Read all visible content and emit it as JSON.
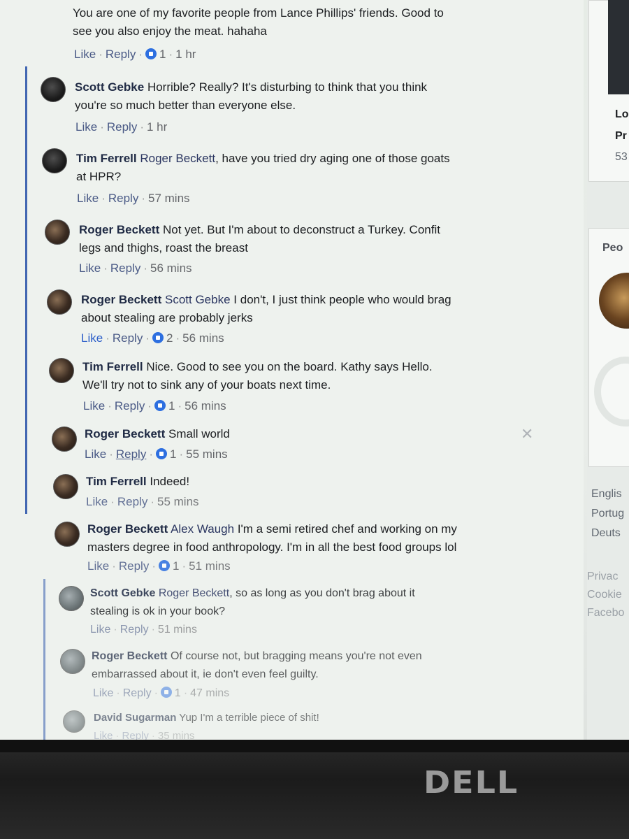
{
  "comments": [
    {
      "author": "",
      "mention": "",
      "text": "You are one of my favorite people from Lance Phillips' friends. Good to",
      "text2": "see you also enjoy the meat. hahaha",
      "like": "Like",
      "reply": "Reply",
      "reactions": "1",
      "time": "1 hr"
    },
    {
      "author": "Scott Gebke",
      "mention": "",
      "text": "Horrible? Really? It's disturbing to think that you think",
      "text2": "you're so much better than everyone else.",
      "like": "Like",
      "reply": "Reply",
      "reactions": "",
      "time": "1 hr"
    },
    {
      "author": "Tim Ferrell",
      "mention": "Roger Beckett",
      "text": ", have you tried dry aging one of those goats",
      "text2": "at HPR?",
      "like": "Like",
      "reply": "Reply",
      "reactions": "",
      "time": "57 mins"
    },
    {
      "author": "Roger Beckett",
      "mention": "",
      "text": "Not yet. But I'm about to deconstruct a Turkey. Confit",
      "text2": "legs and thighs, roast the breast",
      "like": "Like",
      "reply": "Reply",
      "reactions": "",
      "time": "56 mins"
    },
    {
      "author": "Roger Beckett",
      "mention": "Scott Gebke",
      "text": "I don't, I just think people who would brag",
      "text2": "about stealing are probably jerks",
      "like": "Like",
      "reply": "Reply",
      "reactions": "2",
      "time": "56 mins"
    },
    {
      "author": "Tim Ferrell",
      "mention": "",
      "text": "Nice. Good to see you on the board. Kathy says Hello.",
      "text2": "We'll try not to sink any of your boats next time.",
      "like": "Like",
      "reply": "Reply",
      "reactions": "1",
      "time": "56 mins"
    },
    {
      "author": "Roger Beckett",
      "mention": "",
      "text": "Small world",
      "text2": "",
      "like": "Like",
      "reply": "Reply",
      "reactions": "1",
      "time": "55 mins"
    },
    {
      "author": "Tim Ferrell",
      "mention": "",
      "text": "Indeed!",
      "text2": "",
      "like": "Like",
      "reply": "Reply",
      "reactions": "",
      "time": "55 mins"
    },
    {
      "author": "Roger Beckett",
      "mention": "Alex Waugh",
      "text": "I'm a semi retired chef and working on my",
      "text2": "masters degree in food anthropology. I'm in all the best food groups lol",
      "like": "Like",
      "reply": "Reply",
      "reactions": "1",
      "time": "51 mins"
    },
    {
      "author": "Scott Gebke",
      "mention": "Roger Beckett",
      "text": ", so as long as you don't brag about it",
      "text2": "stealing is ok in your book?",
      "like": "Like",
      "reply": "Reply",
      "reactions": "",
      "time": "51 mins"
    },
    {
      "author": "Roger Beckett",
      "mention": "",
      "text": "Of course not, but bragging means you're not even",
      "text2": "embarrassed about it, ie don't even feel guilty.",
      "like": "Like",
      "reply": "Reply",
      "reactions": "1",
      "time": "47 mins"
    },
    {
      "author": "David Sugarman",
      "mention": "",
      "text": "Yup I'm a terrible piece of shit!",
      "text2": "",
      "like": "Like",
      "reply": "Reply",
      "reactions": "",
      "time": "35 mins"
    }
  ],
  "sidebar": {
    "card_line1": "Lo",
    "card_line2": "Pr",
    "card_line3": "53",
    "people_heading": "Peo",
    "languages": [
      "Englis",
      "Portug",
      "Deuts"
    ],
    "footer_links": [
      "Privac",
      "Cookie",
      "Facebo"
    ]
  },
  "monitor": {
    "brand": "DELL"
  },
  "colors": {
    "accent": "#4267b2",
    "reaction": "#2d6fe0"
  }
}
